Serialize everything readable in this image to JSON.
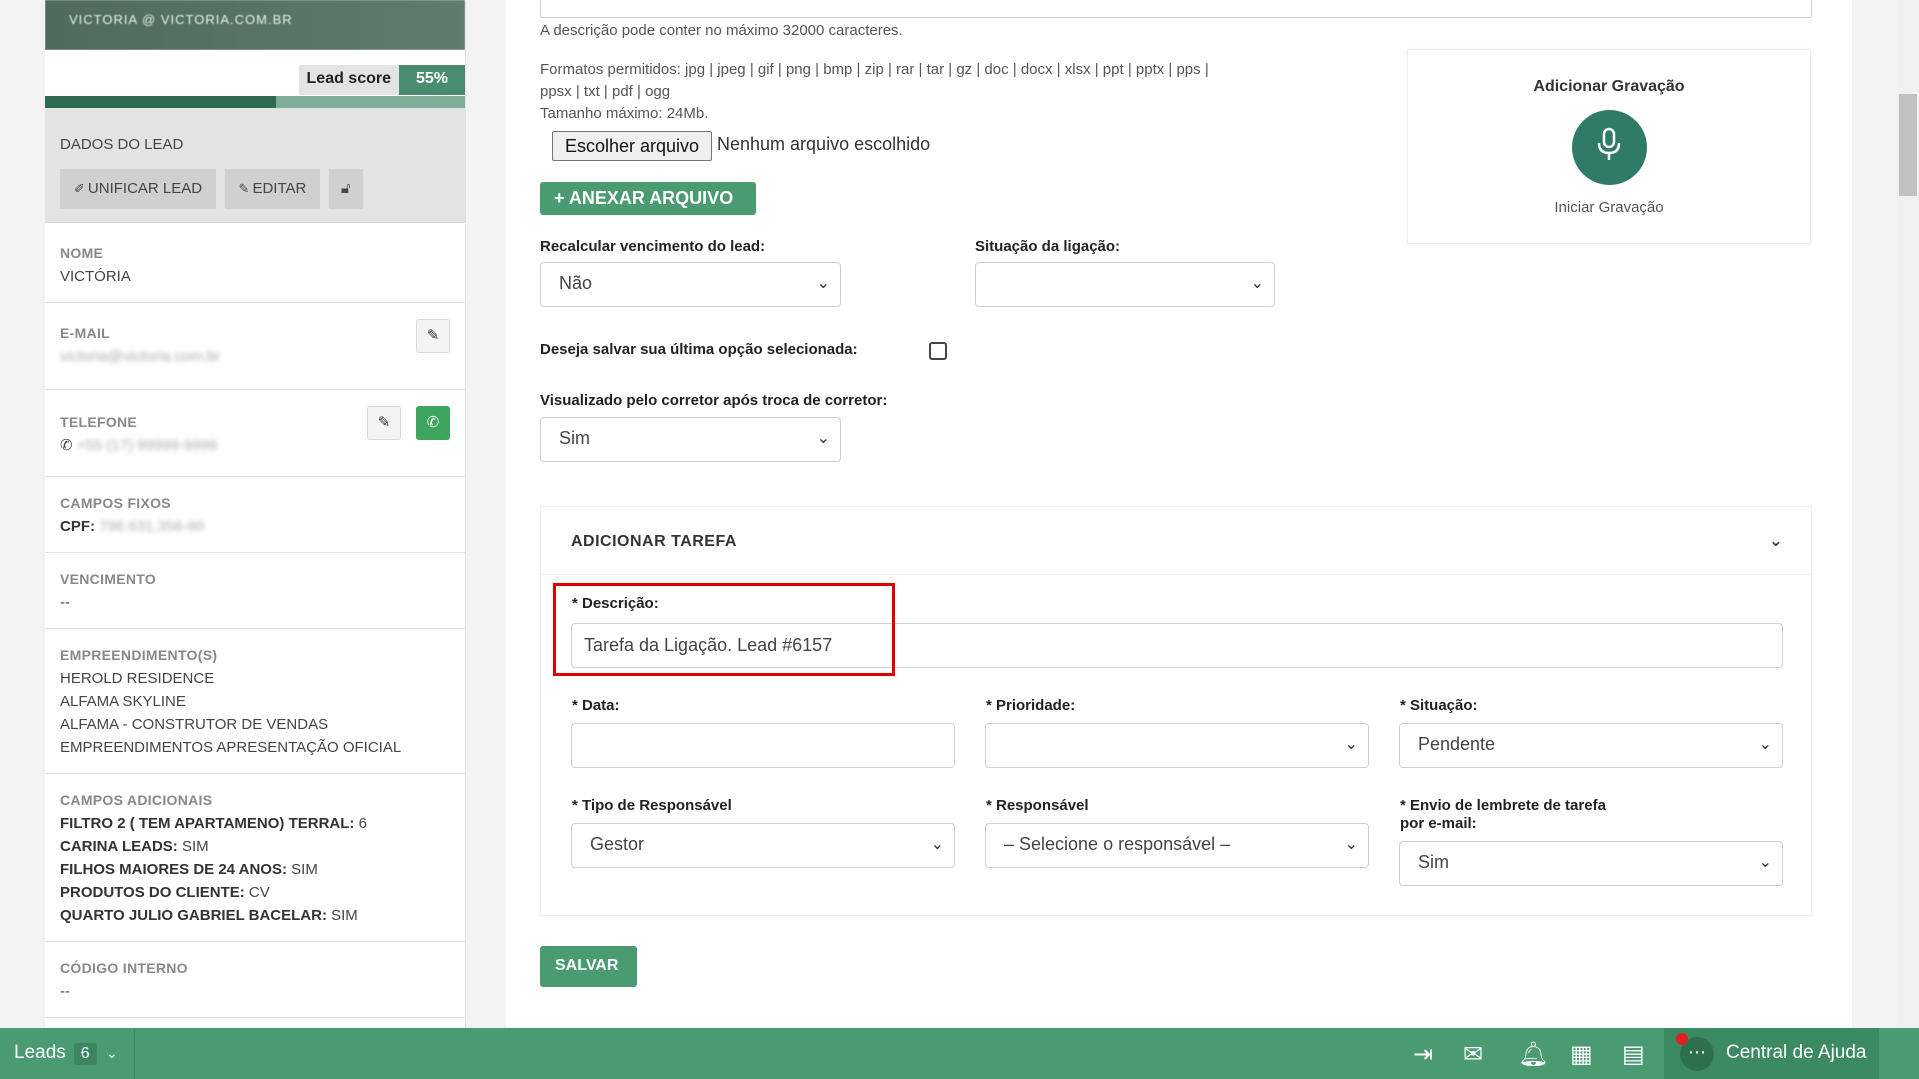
{
  "lead": {
    "header_name": "VICTORIA @ VICTORIA.COM.BR",
    "score_label": "Lead score",
    "score_value": "55%",
    "score_fraction": 0.55,
    "dados_title": "DADOS DO LEAD",
    "unify_label": "UNIFICAR LEAD",
    "edit_label": "EDITAR",
    "fields": {
      "nome_label": "NOME",
      "nome_value": "VICTÓRIA",
      "email_label": "E-MAIL",
      "email_value": "victoria@victoria.com.br",
      "telefone_label": "TELEFONE",
      "telefone_value": "+55 (17) 99999-9999",
      "campos_fixos_label": "CAMPOS FIXOS",
      "cpf_key": "CPF:",
      "cpf_value": "796.631.356-60",
      "vencimento_label": "VENCIMENTO",
      "vencimento_value": "--",
      "empreendimentos_label": "EMPREENDIMENTO(S)",
      "empreendimentos": [
        "HEROLD RESIDENCE",
        "ALFAMA SKYLINE",
        "ALFAMA - CONSTRUTOR DE VENDAS",
        "EMPREENDIMENTOS APRESENTAÇÃO OFICIAL"
      ],
      "campos_adicionais_label": "CAMPOS ADICIONAIS",
      "adicionais": [
        {
          "key": "FILTRO 2 ( TEM APARTAMENO) TERRAL:",
          "value": "6"
        },
        {
          "key": "CARINA LEADS:",
          "value": "SIM"
        },
        {
          "key": "FILHOS MAIORES DE 24 ANOS:",
          "value": "SIM"
        },
        {
          "key": "PRODUTOS DO CLIENTE:",
          "value": "CV"
        },
        {
          "key": "QUARTO JULIO GABRIEL BACELAR:",
          "value": "SIM"
        }
      ],
      "codigo_label": "CÓDIGO INTERNO",
      "codigo_value": "--"
    }
  },
  "form": {
    "desc_limit": "A descrição pode conter no máximo 32000 caracteres.",
    "formats_line1": "Formatos permitidos: jpg | jpeg | gif | png | bmp | zip | rar | tar | gz | doc | docx | xlsx | ppt | pptx | pps |",
    "formats_line2": "ppsx | txt | pdf | ogg",
    "max_size": "Tamanho máximo: 24Mb.",
    "file_button": "Escolher arquivo",
    "file_none": "Nenhum arquivo escolhido",
    "attach_button": "+ ANEXAR ARQUIVO",
    "recalc_label": "Recalcular vencimento do lead:",
    "recalc_value": "Não",
    "situacao_ligacao_label": "Situação da ligação:",
    "situacao_ligacao_value": "",
    "save_option_label": "Deseja salvar sua última opção selecionada:",
    "visualizado_label": "Visualizado pelo corretor após troca de corretor:",
    "visualizado_value": "Sim",
    "recording_title": "Adicionar Gravação",
    "recording_sub": "Iniciar Gravação"
  },
  "task": {
    "title": "ADICIONAR TAREFA",
    "descricao_label": "* Descrição:",
    "descricao_value": "Tarefa da Ligação. Lead #6157",
    "data_label": "* Data:",
    "data_value": "",
    "prioridade_label": "* Prioridade:",
    "prioridade_value": "",
    "situacao_label": "* Situação:",
    "situacao_value": "Pendente",
    "tipo_resp_label": "* Tipo de Responsável",
    "tipo_resp_value": "Gestor",
    "responsavel_label": "* Responsável",
    "responsavel_value": "– Selecione o responsável –",
    "lembrete_label_1": "* Envio de lembrete de tarefa",
    "lembrete_label_2": "por e-mail:",
    "lembrete_value": "Sim",
    "save_button": "SALVAR"
  },
  "bottom_bar": {
    "leads_label": "Leads",
    "leads_count": "6",
    "help_label": "Central de Ajuda"
  },
  "colors": {
    "brand_green": "#4a9a72",
    "dark_green": "#2f7b67",
    "highlight_red": "#e00000"
  }
}
